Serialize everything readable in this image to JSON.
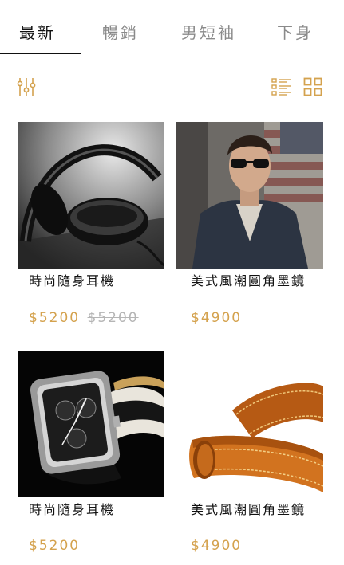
{
  "tabs": [
    {
      "label": "最新",
      "active": true
    },
    {
      "label": "暢銷",
      "active": false
    },
    {
      "label": "男短袖",
      "active": false
    },
    {
      "label": "下身",
      "active": false
    }
  ],
  "toolbar": {
    "filter_icon": "sliders-icon",
    "list_icon": "list-view-icon",
    "grid_icon": "grid-view-icon",
    "accent_color": "#d4a24e"
  },
  "products": [
    {
      "name": "時尚隨身耳機",
      "price": "$5200",
      "original_price": "$5200",
      "image": "headphones"
    },
    {
      "name": "美式風潮圓角墨鏡",
      "price": "$4900",
      "image": "man-in-sunglasses"
    },
    {
      "name": "時尚隨身耳機",
      "price": "$5200",
      "image": "wristwatch"
    },
    {
      "name": "美式風潮圓角墨鏡",
      "price": "$4900",
      "image": "leather-belt"
    }
  ]
}
